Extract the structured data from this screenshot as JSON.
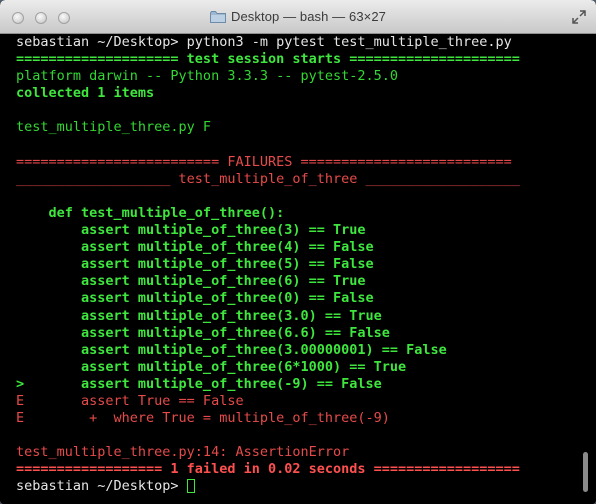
{
  "window": {
    "title": "Desktop — bash — 63×27"
  },
  "terminal": {
    "lines": [
      {
        "text": "sebastian ~/Desktop> python3 -m pytest test_multiple_three.py",
        "style": "white"
      },
      {
        "text": "==================== test session starts =====================",
        "style": "green-b"
      },
      {
        "text": "platform darwin -- Python 3.3.3 -- pytest-2.5.0",
        "style": "green"
      },
      {
        "text": "collected 1 items",
        "style": "green-b"
      },
      {
        "text": "",
        "style": "white"
      },
      {
        "text": "test_multiple_three.py F",
        "style": "green"
      },
      {
        "text": "",
        "style": "white"
      },
      {
        "text": "========================= FAILURES ==========================",
        "style": "red"
      },
      {
        "text": "___________________ test_multiple_of_three ___________________",
        "style": "red"
      },
      {
        "text": "",
        "style": "white"
      },
      {
        "text": "    def test_multiple_of_three():",
        "style": "green-b"
      },
      {
        "text": "        assert multiple_of_three(3) == True",
        "style": "green-b"
      },
      {
        "text": "        assert multiple_of_three(4) == False",
        "style": "green-b"
      },
      {
        "text": "        assert multiple_of_three(5) == False",
        "style": "green-b"
      },
      {
        "text": "        assert multiple_of_three(6) == True",
        "style": "green-b"
      },
      {
        "text": "        assert multiple_of_three(0) == False",
        "style": "green-b"
      },
      {
        "text": "        assert multiple_of_three(3.0) == True",
        "style": "green-b"
      },
      {
        "text": "        assert multiple_of_three(6.6) == False",
        "style": "green-b"
      },
      {
        "text": "        assert multiple_of_three(3.00000001) == False",
        "style": "green-b"
      },
      {
        "text": "        assert multiple_of_three(6*1000) == True",
        "style": "green-b"
      },
      {
        "text": ">       assert multiple_of_three(-9) == False",
        "style": "green-b"
      },
      {
        "text": "E       assert True == False",
        "style": "red"
      },
      {
        "text": "E        +  where True = multiple_of_three(-9)",
        "style": "red"
      },
      {
        "text": "",
        "style": "white"
      },
      {
        "text": "test_multiple_three.py:14: AssertionError",
        "style": "red"
      },
      {
        "text": "================== 1 failed in 0.02 seconds ==================",
        "style": "red-b"
      },
      {
        "text": "sebastian ~/Desktop> ",
        "style": "white",
        "cursor": true
      }
    ]
  },
  "colors": {
    "background": "#000000",
    "green": "#33d633",
    "red": "#e64a4a",
    "white": "#e6e6e6"
  },
  "icons": [
    "folder-icon",
    "fullscreen-icon"
  ]
}
